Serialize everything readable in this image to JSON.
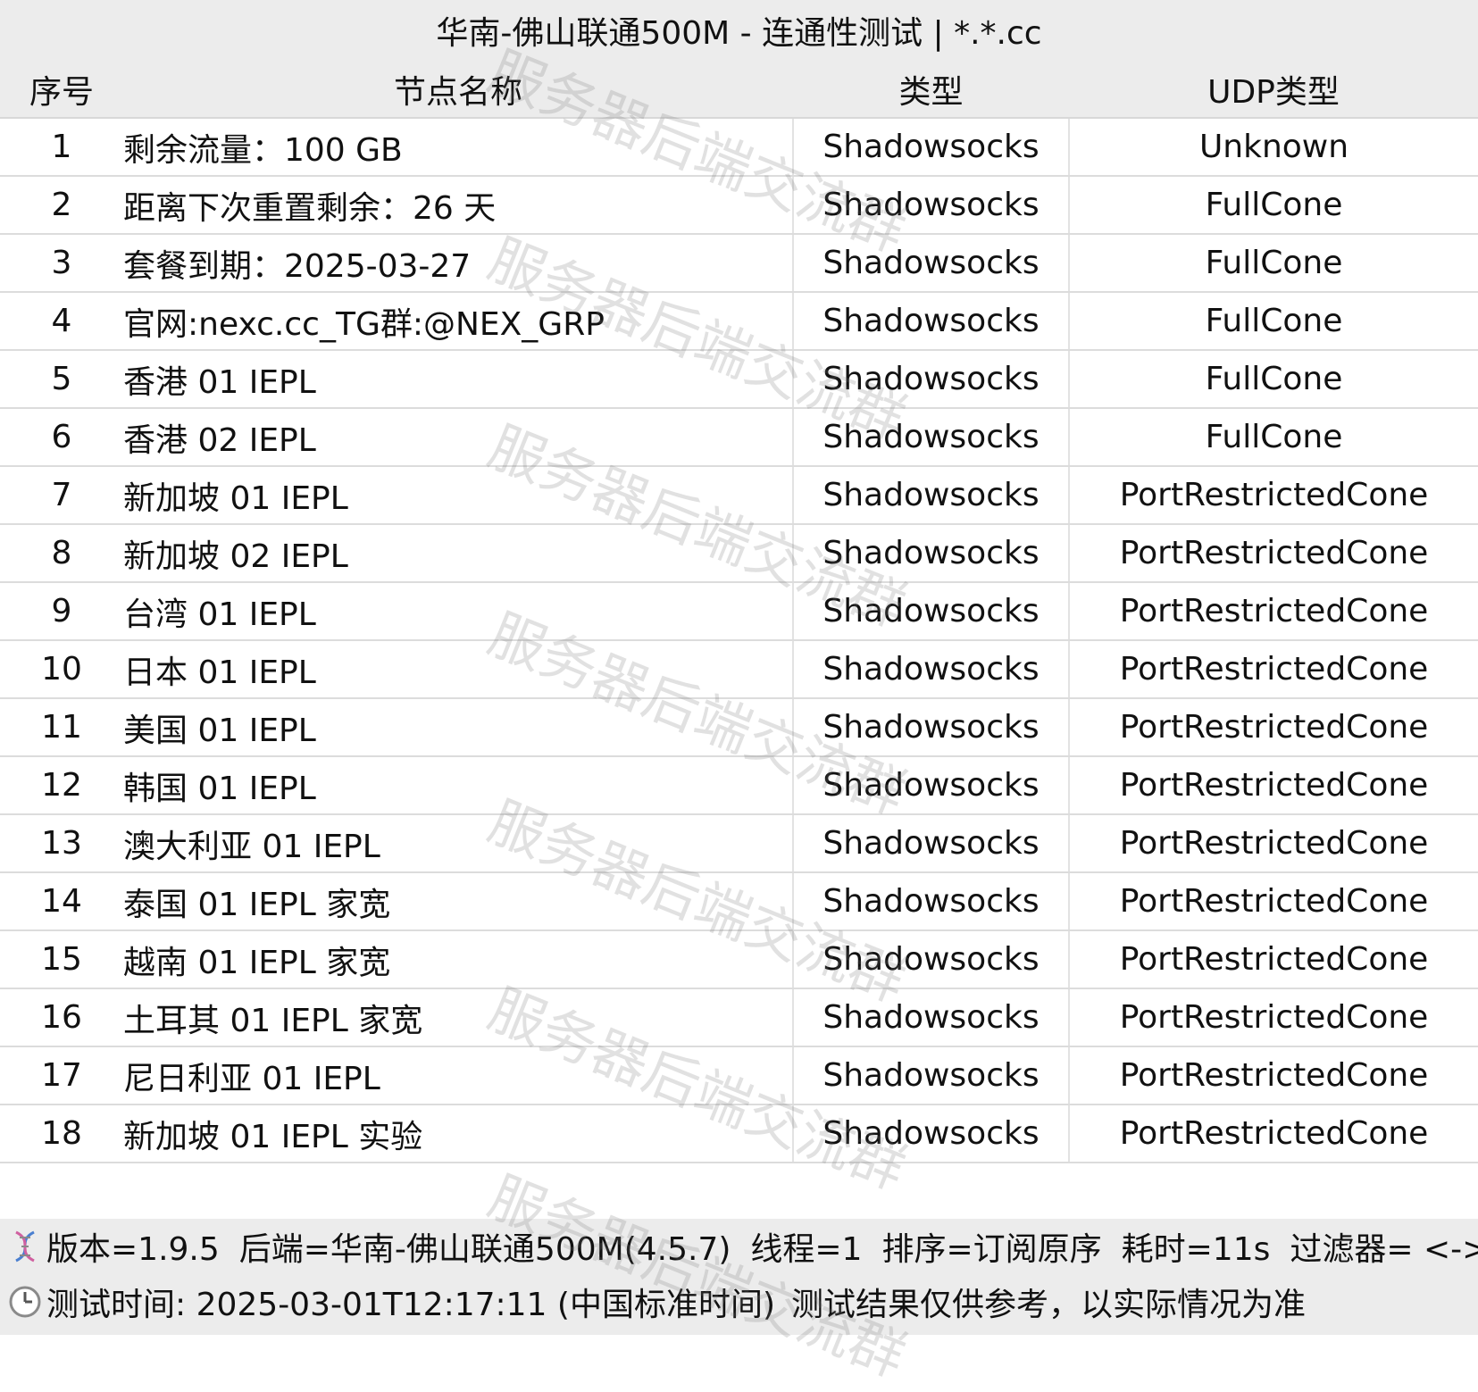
{
  "title": "华南-佛山联通500M - 连通性测试 | *.*.cc",
  "headers": {
    "index": "序号",
    "name": "节点名称",
    "type": "类型",
    "udp": "UDP类型"
  },
  "rows": [
    {
      "index": "1",
      "name": "剩余流量：100 GB",
      "type": "Shadowsocks",
      "udp": "Unknown"
    },
    {
      "index": "2",
      "name": "距离下次重置剩余：26 天",
      "type": "Shadowsocks",
      "udp": "FullCone"
    },
    {
      "index": "3",
      "name": "套餐到期：2025-03-27",
      "type": "Shadowsocks",
      "udp": "FullCone"
    },
    {
      "index": "4",
      "name": "官网:nexc.cc_TG群:@NEX_GRP",
      "type": "Shadowsocks",
      "udp": "FullCone"
    },
    {
      "index": "5",
      "name": "香港 01 IEPL",
      "type": "Shadowsocks",
      "udp": "FullCone"
    },
    {
      "index": "6",
      "name": "香港 02 IEPL",
      "type": "Shadowsocks",
      "udp": "FullCone"
    },
    {
      "index": "7",
      "name": "新加坡 01 IEPL",
      "type": "Shadowsocks",
      "udp": "PortRestrictedCone"
    },
    {
      "index": "8",
      "name": "新加坡 02 IEPL",
      "type": "Shadowsocks",
      "udp": "PortRestrictedCone"
    },
    {
      "index": "9",
      "name": "台湾 01 IEPL",
      "type": "Shadowsocks",
      "udp": "PortRestrictedCone"
    },
    {
      "index": "10",
      "name": "日本 01 IEPL",
      "type": "Shadowsocks",
      "udp": "PortRestrictedCone"
    },
    {
      "index": "11",
      "name": "美国 01 IEPL",
      "type": "Shadowsocks",
      "udp": "PortRestrictedCone"
    },
    {
      "index": "12",
      "name": "韩国 01 IEPL",
      "type": "Shadowsocks",
      "udp": "PortRestrictedCone"
    },
    {
      "index": "13",
      "name": "澳大利亚 01 IEPL",
      "type": "Shadowsocks",
      "udp": "PortRestrictedCone"
    },
    {
      "index": "14",
      "name": "泰国 01 IEPL 家宽",
      "type": "Shadowsocks",
      "udp": "PortRestrictedCone"
    },
    {
      "index": "15",
      "name": "越南 01 IEPL 家宽",
      "type": "Shadowsocks",
      "udp": "PortRestrictedCone"
    },
    {
      "index": "16",
      "name": "土耳其 01 IEPL 家宽",
      "type": "Shadowsocks",
      "udp": "PortRestrictedCone"
    },
    {
      "index": "17",
      "name": "尼日利亚 01 IEPL",
      "type": "Shadowsocks",
      "udp": "PortRestrictedCone"
    },
    {
      "index": "18",
      "name": "新加坡 01 IEPL 实验",
      "type": "Shadowsocks",
      "udp": "PortRestrictedCone"
    }
  ],
  "footer": {
    "version": "版本=1.9.5",
    "backend": "后端=华南-佛山联通500M(4.5.7)",
    "threads": "线程=1",
    "sort": "排序=订阅原序",
    "elapsed": "耗时=11s",
    "filter": "过滤器= <->",
    "test_time": "测试时间: 2025-03-01T12:17:11 (中国标准时间)",
    "disclaimer": "测试结果仅供参考，以实际情况为准",
    "version_icon": "dna-icon",
    "time_icon": "clock-icon"
  },
  "watermark": "服务器后端交流群"
}
